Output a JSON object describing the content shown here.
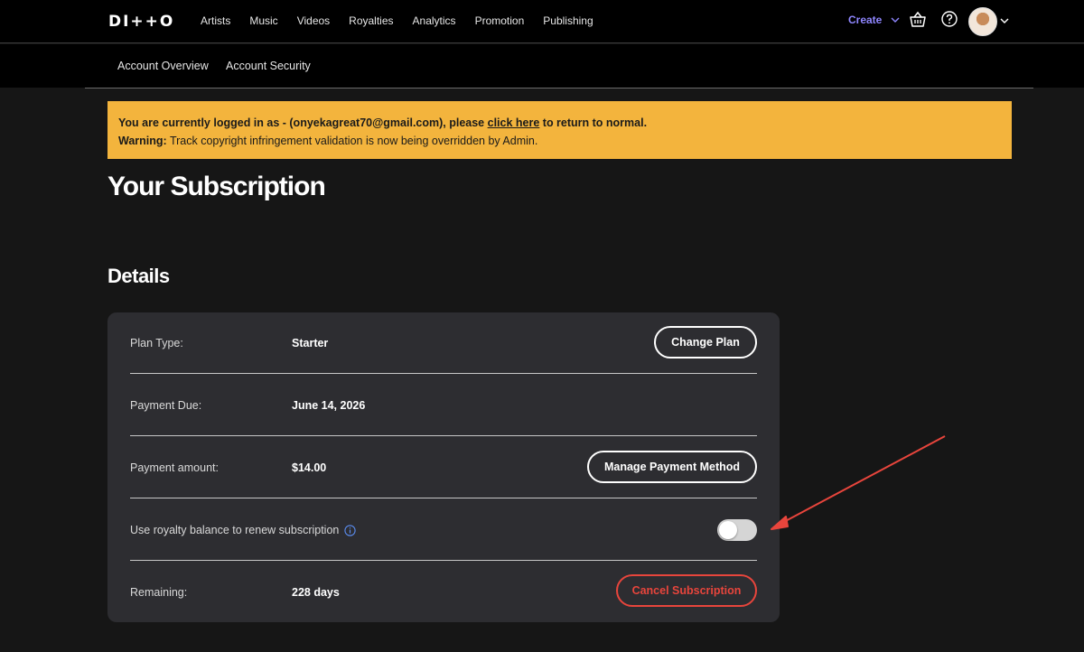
{
  "nav": {
    "logo": "DI++O",
    "links": [
      "Artists",
      "Music",
      "Videos",
      "Royalties",
      "Analytics",
      "Promotion",
      "Publishing"
    ],
    "create_label": "Create"
  },
  "subnav": {
    "items": [
      "Account Overview",
      "Account Security"
    ]
  },
  "banner": {
    "line1_prefix": "You are currently logged in as - (onyekagreat70@gmail.com), please ",
    "line1_link": "click here",
    "line1_suffix": " to return to normal.",
    "warning_label": "Warning:",
    "warning_text": " Track copyright infringement validation is now being overridden by Admin.",
    "color": "#f3b43d"
  },
  "page": {
    "title": "Your Subscription",
    "section_title": "Details"
  },
  "details": {
    "plan_type_label": "Plan Type:",
    "plan_type_value": "Starter",
    "change_plan_button": "Change Plan",
    "payment_due_label": "Payment Due:",
    "payment_due_value": "June 14, 2026",
    "payment_amount_label": "Payment amount:",
    "payment_amount_value": "$14.00",
    "manage_payment_button": "Manage Payment Method",
    "royalty_label": "Use royalty balance to renew subscription",
    "royalty_toggle_on": false,
    "remaining_label": "Remaining:",
    "remaining_value": "228 days",
    "cancel_button": "Cancel Subscription"
  },
  "colors": {
    "accent": "#8f86ff",
    "danger": "#e8453c",
    "card_bg": "#2d2d31",
    "annotation_arrow": "#e8453c"
  },
  "icons": {
    "basket": "basket-icon",
    "help": "help-icon",
    "info": "info-icon",
    "chevron": "chevron-down-icon"
  }
}
